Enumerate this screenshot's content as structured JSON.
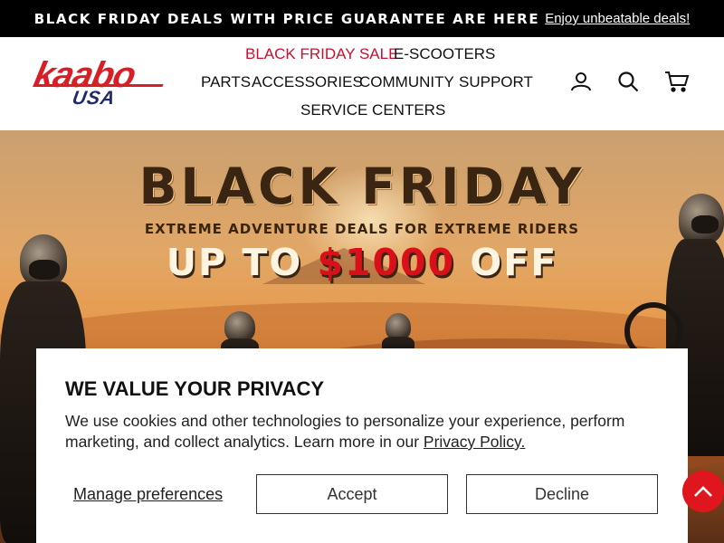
{
  "announcement": {
    "message": "BLACK FRIDAY DEALS WITH PRICE GUARANTEE ARE HERE",
    "link_text": "Enjoy unbeatable deals!"
  },
  "logo": {
    "brand": "kaabo",
    "region": "USA"
  },
  "nav": {
    "black_friday_sale": "BLACK FRIDAY SALE",
    "e_scooters": "E-SCOOTERS",
    "parts": "PARTS",
    "accessories": "ACCESSORIES",
    "community": "COMMUNITY",
    "support": "SUPPORT",
    "service_centers": "SERVICE CENTERS"
  },
  "header_icons": [
    "user-icon",
    "search-icon",
    "cart-icon"
  ],
  "hero": {
    "title": "BLACK FRIDAY",
    "subtitle": "EXTREME ADVENTURE DEALS FOR EXTREME RIDERS",
    "offer_prefix": "UP TO ",
    "offer_amount": "$1000",
    "offer_suffix": " OFF"
  },
  "privacy": {
    "heading": "WE VALUE YOUR PRIVACY",
    "body": "We use cookies and other technologies to personalize your experience, perform marketing, and collect analytics. Learn more in our ",
    "policy_link": "Privacy Policy.",
    "manage_label": "Manage preferences",
    "accept_label": "Accept",
    "decline_label": "Decline"
  },
  "colors": {
    "brand_red": "#d81f26",
    "sale_red": "#c8102e",
    "navy": "#1f2a6b",
    "scroll_top_red": "#e0161e"
  }
}
